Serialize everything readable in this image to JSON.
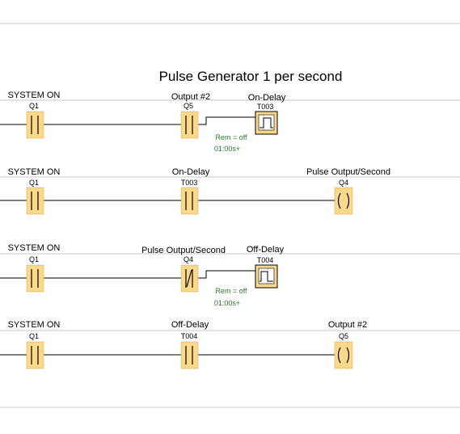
{
  "diagram": {
    "title": "Pulse Generator 1 per second",
    "colors": {
      "element_fill": "#fbd88a",
      "element_stroke": "#d9a34a",
      "grid_line": "#c8c8c8",
      "wire": "#000000",
      "param_text": "#2a7a2a"
    },
    "rungs": [
      {
        "contact_1": {
          "label": "SYSTEM ON",
          "address": "Q1",
          "type": "no-contact"
        },
        "contact_2": {
          "label": "Output #2",
          "address": "Q5",
          "type": "no-contact"
        },
        "timer": {
          "label": "On-Delay",
          "address": "T003",
          "rem": "Rem = off",
          "time": "01:00s+"
        }
      },
      {
        "contact_1": {
          "label": "SYSTEM ON",
          "address": "Q1",
          "type": "no-contact"
        },
        "contact_2": {
          "label": "On-Delay",
          "address": "T003",
          "type": "no-contact"
        },
        "coil": {
          "label": "Pulse Output/Second",
          "address": "Q4"
        }
      },
      {
        "contact_1": {
          "label": "SYSTEM ON",
          "address": "Q1",
          "type": "no-contact"
        },
        "contact_2": {
          "label": "Pulse Output/Second",
          "address": "Q4",
          "type": "nc-contact"
        },
        "timer": {
          "label": "Off-Delay",
          "address": "T004",
          "rem": "Rem = off",
          "time": "01:00s+"
        }
      },
      {
        "contact_1": {
          "label": "SYSTEM ON",
          "address": "Q1",
          "type": "no-contact"
        },
        "contact_2": {
          "label": "Off-Delay",
          "address": "T004",
          "type": "no-contact"
        },
        "coil": {
          "label": "Output #2",
          "address": "Q5"
        }
      }
    ]
  }
}
